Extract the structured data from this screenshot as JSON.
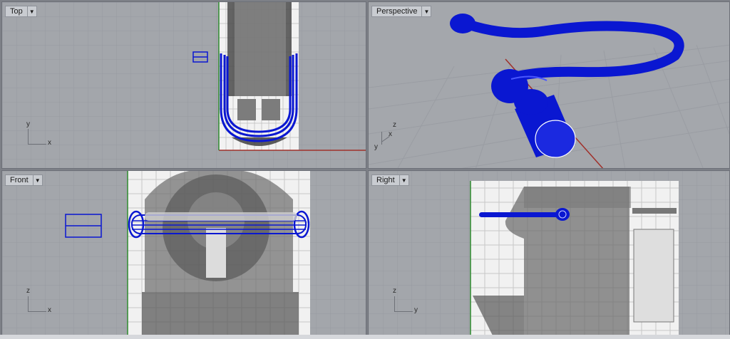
{
  "viewports": {
    "top": {
      "label": "Top",
      "axis_x": "x",
      "axis_y": "y"
    },
    "perspective": {
      "label": "Perspective",
      "axis_x": "x",
      "axis_y": "y",
      "axis_z": "z"
    },
    "front": {
      "label": "Front",
      "axis_x": "x",
      "axis_z": "z"
    },
    "right": {
      "label": "Right",
      "axis_y": "y",
      "axis_z": "z"
    }
  },
  "dropdown_icon": "chevron-down-icon",
  "colors": {
    "viewport_bg": "#a3a6ab",
    "grid": "#969aa0",
    "curve": "#0a17d1",
    "x_axis": "#a0302a",
    "y_axis": "#2e8a2e"
  }
}
